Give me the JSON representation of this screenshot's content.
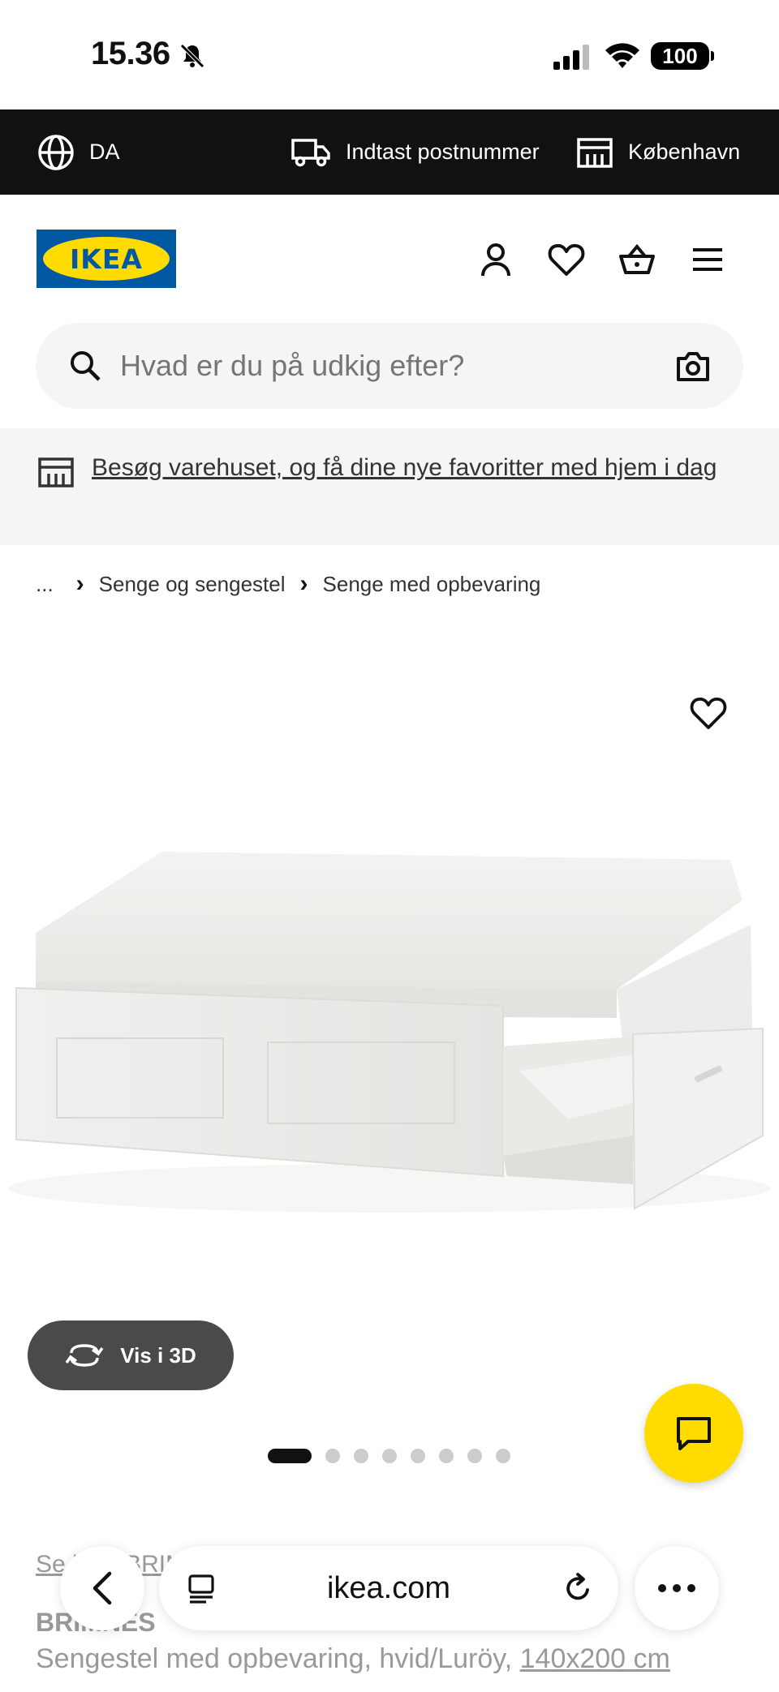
{
  "status_bar": {
    "time": "15.36",
    "battery": "100"
  },
  "top_bar": {
    "language": "DA",
    "postcode": "Indtast postnummer",
    "store": "København"
  },
  "header": {
    "logo_text": "IKEA",
    "icons": [
      "account-icon",
      "heart-icon",
      "basket-icon",
      "menu-icon"
    ]
  },
  "search": {
    "placeholder": "Hvad er du på udkig efter?"
  },
  "banner": {
    "text": "Besøg varehuset, og få dine nye favoritter med hjem i dag"
  },
  "breadcrumb": {
    "ellipsis": "...",
    "items": [
      "Senge og sengestel",
      "Senge med opbevaring"
    ]
  },
  "product": {
    "view_3d_label": "Vis i 3D",
    "series_link": "Se hele BRIMNES serien",
    "name": "BRIMNES",
    "description": "Sengestel med opbevaring, hvid/Luröy, ",
    "size": "140x200 cm",
    "image_count": 8,
    "active_image": 1
  },
  "browser": {
    "url": "ikea.com"
  },
  "colors": {
    "ikea_blue": "#0058a3",
    "ikea_yellow": "#ffdb00",
    "top_bar": "#111111"
  }
}
